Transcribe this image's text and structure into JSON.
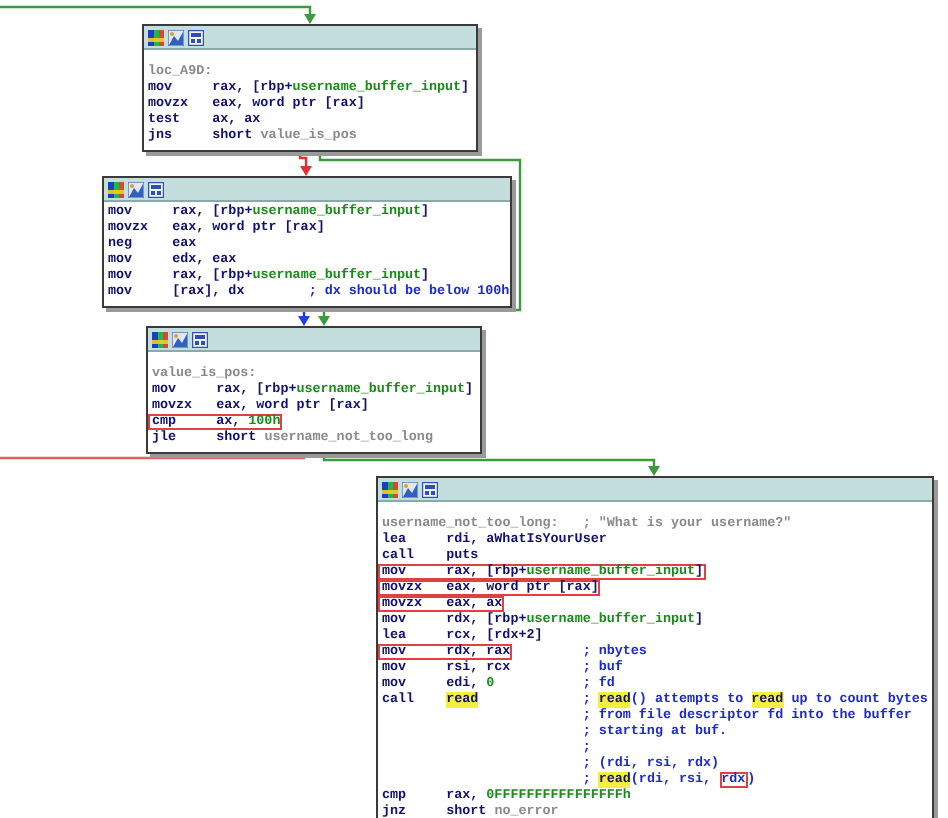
{
  "nodes": [
    {
      "lines": [
        {
          "kind": "label",
          "label": "loc_A9D:"
        },
        {
          "kind": "instruction",
          "mnemonic": "mov",
          "boxed": false,
          "operands": [
            {
              "text": "rax, [rbp+",
              "kind": "reg"
            },
            {
              "text": "username_buffer_input",
              "kind": "var"
            },
            {
              "text": "]",
              "kind": "reg"
            }
          ]
        },
        {
          "kind": "instruction",
          "mnemonic": "movzx",
          "boxed": false,
          "operands": [
            {
              "text": "eax, word ptr [rax]",
              "kind": "reg"
            }
          ]
        },
        {
          "kind": "instruction",
          "mnemonic": "test",
          "boxed": false,
          "operands": [
            {
              "text": "ax, ax",
              "kind": "reg"
            }
          ]
        },
        {
          "kind": "instruction",
          "mnemonic": "jns",
          "boxed": false,
          "operands": [
            {
              "text": "short ",
              "kind": "reg"
            },
            {
              "text": "value_is_pos",
              "kind": "ref"
            }
          ]
        }
      ]
    },
    {
      "lines": [
        {
          "kind": "instruction",
          "mnemonic": "mov",
          "boxed": false,
          "operands": [
            {
              "text": "rax, [rbp+",
              "kind": "reg"
            },
            {
              "text": "username_buffer_input",
              "kind": "var"
            },
            {
              "text": "]",
              "kind": "reg"
            }
          ]
        },
        {
          "kind": "instruction",
          "mnemonic": "movzx",
          "boxed": false,
          "operands": [
            {
              "text": "eax, word ptr [rax]",
              "kind": "reg"
            }
          ]
        },
        {
          "kind": "instruction",
          "mnemonic": "neg",
          "boxed": false,
          "operands": [
            {
              "text": "eax",
              "kind": "reg"
            }
          ]
        },
        {
          "kind": "instruction",
          "mnemonic": "mov",
          "boxed": false,
          "operands": [
            {
              "text": "edx, eax",
              "kind": "reg"
            }
          ]
        },
        {
          "kind": "instruction",
          "mnemonic": "mov",
          "boxed": false,
          "operands": [
            {
              "text": "rax, [rbp+",
              "kind": "reg"
            },
            {
              "text": "username_buffer_input",
              "kind": "var"
            },
            {
              "text": "]",
              "kind": "reg"
            }
          ]
        },
        {
          "kind": "instruction",
          "mnemonic": "mov",
          "boxed": false,
          "operands": [
            {
              "text": "[rax], dx",
              "kind": "reg"
            }
          ],
          "comment": [
            {
              "text": "; dx should be below 100h",
              "kind": "plain"
            }
          ]
        }
      ]
    },
    {
      "lines": [
        {
          "kind": "label",
          "label": "value_is_pos:"
        },
        {
          "kind": "instruction",
          "mnemonic": "mov",
          "boxed": false,
          "operands": [
            {
              "text": "rax, [rbp+",
              "kind": "reg"
            },
            {
              "text": "username_buffer_input",
              "kind": "var"
            },
            {
              "text": "]",
              "kind": "reg"
            }
          ]
        },
        {
          "kind": "instruction",
          "mnemonic": "movzx",
          "boxed": false,
          "operands": [
            {
              "text": "eax, word ptr [rax]",
              "kind": "reg"
            }
          ]
        },
        {
          "kind": "instruction",
          "mnemonic": "cmp",
          "boxed": true,
          "operands": [
            {
              "text": "ax, ",
              "kind": "reg"
            },
            {
              "text": "100h",
              "kind": "num"
            }
          ]
        },
        {
          "kind": "instruction",
          "mnemonic": "jle",
          "boxed": false,
          "operands": [
            {
              "text": "short ",
              "kind": "reg"
            },
            {
              "text": "username_not_too_long",
              "kind": "ref"
            }
          ]
        }
      ]
    },
    {
      "lines": [
        {
          "kind": "label",
          "label": "username_not_too_long:",
          "comment": [
            {
              "text": "; \"What is your username?\"",
              "kind": "ref"
            }
          ]
        },
        {
          "kind": "instruction",
          "mnemonic": "lea",
          "boxed": false,
          "operands": [
            {
              "text": "rdi, aWhatIsYourUser",
              "kind": "reg"
            }
          ]
        },
        {
          "kind": "instruction",
          "mnemonic": "call",
          "boxed": false,
          "operands": [
            {
              "text": "puts",
              "kind": "reg"
            }
          ]
        },
        {
          "kind": "instruction",
          "mnemonic": "mov",
          "boxed": true,
          "operands": [
            {
              "text": "rax, [rbp+",
              "kind": "reg"
            },
            {
              "text": "username_buffer_input",
              "kind": "var"
            },
            {
              "text": "]",
              "kind": "reg"
            }
          ]
        },
        {
          "kind": "instruction",
          "mnemonic": "movzx",
          "boxed": true,
          "operands": [
            {
              "text": "eax, word ptr [rax]",
              "kind": "reg"
            }
          ]
        },
        {
          "kind": "instruction",
          "mnemonic": "movzx",
          "boxed": true,
          "operands": [
            {
              "text": "eax, ax",
              "kind": "reg"
            }
          ]
        },
        {
          "kind": "instruction",
          "mnemonic": "mov",
          "boxed": false,
          "operands": [
            {
              "text": "rdx, [rbp+",
              "kind": "reg"
            },
            {
              "text": "username_buffer_input",
              "kind": "var"
            },
            {
              "text": "]",
              "kind": "reg"
            }
          ]
        },
        {
          "kind": "instruction",
          "mnemonic": "lea",
          "boxed": false,
          "operands": [
            {
              "text": "rcx, [rdx+2]",
              "kind": "reg"
            }
          ]
        },
        {
          "kind": "instruction",
          "mnemonic": "mov",
          "boxed": true,
          "operands": [
            {
              "text": "rdx, rax",
              "kind": "reg"
            }
          ],
          "comment": [
            {
              "text": "; nbytes",
              "kind": "plain"
            }
          ]
        },
        {
          "kind": "instruction",
          "mnemonic": "mov",
          "boxed": false,
          "operands": [
            {
              "text": "rsi, rcx",
              "kind": "reg"
            }
          ],
          "comment": [
            {
              "text": "; buf",
              "kind": "plain"
            }
          ]
        },
        {
          "kind": "instruction",
          "mnemonic": "mov",
          "boxed": false,
          "operands": [
            {
              "text": "edi, ",
              "kind": "reg"
            },
            {
              "text": "0",
              "kind": "num"
            }
          ],
          "comment": [
            {
              "text": "; fd",
              "kind": "plain"
            }
          ]
        },
        {
          "kind": "instruction",
          "mnemonic": "call",
          "boxed": false,
          "operands": [
            {
              "text": "read",
              "kind": "hl"
            }
          ],
          "comment": [
            {
              "text": "; ",
              "kind": "plain"
            },
            {
              "text": "read",
              "kind": "hl"
            },
            {
              "text": "() attempts to ",
              "kind": "plain"
            },
            {
              "text": "read",
              "kind": "hl"
            },
            {
              "text": " up to count bytes",
              "kind": "plain"
            }
          ]
        },
        {
          "kind": "comment",
          "comment": [
            {
              "text": "; from file descriptor fd into the buffer",
              "kind": "plain"
            }
          ]
        },
        {
          "kind": "comment",
          "comment": [
            {
              "text": "; starting at buf.",
              "kind": "plain"
            }
          ]
        },
        {
          "kind": "comment",
          "comment": [
            {
              "text": ";",
              "kind": "plain"
            }
          ]
        },
        {
          "kind": "comment",
          "comment": [
            {
              "text": "; (rdi, rsi, rdx)",
              "kind": "plain"
            }
          ]
        },
        {
          "kind": "comment",
          "comment": [
            {
              "text": "; ",
              "kind": "plain"
            },
            {
              "text": "read",
              "kind": "hl"
            },
            {
              "text": "(rdi, rsi, ",
              "kind": "plain"
            },
            {
              "text": "rdx",
              "kind": "boxed"
            },
            {
              "text": ")",
              "kind": "plain"
            }
          ]
        },
        {
          "kind": "instruction",
          "mnemonic": "cmp",
          "boxed": false,
          "operands": [
            {
              "text": "rax, ",
              "kind": "reg"
            },
            {
              "text": "0FFFFFFFFFFFFFFFFh",
              "kind": "num"
            }
          ]
        },
        {
          "kind": "instruction",
          "mnemonic": "jnz",
          "boxed": false,
          "operands": [
            {
              "text": "short ",
              "kind": "reg"
            },
            {
              "text": "no_error",
              "kind": "ref"
            }
          ]
        }
      ]
    }
  ]
}
